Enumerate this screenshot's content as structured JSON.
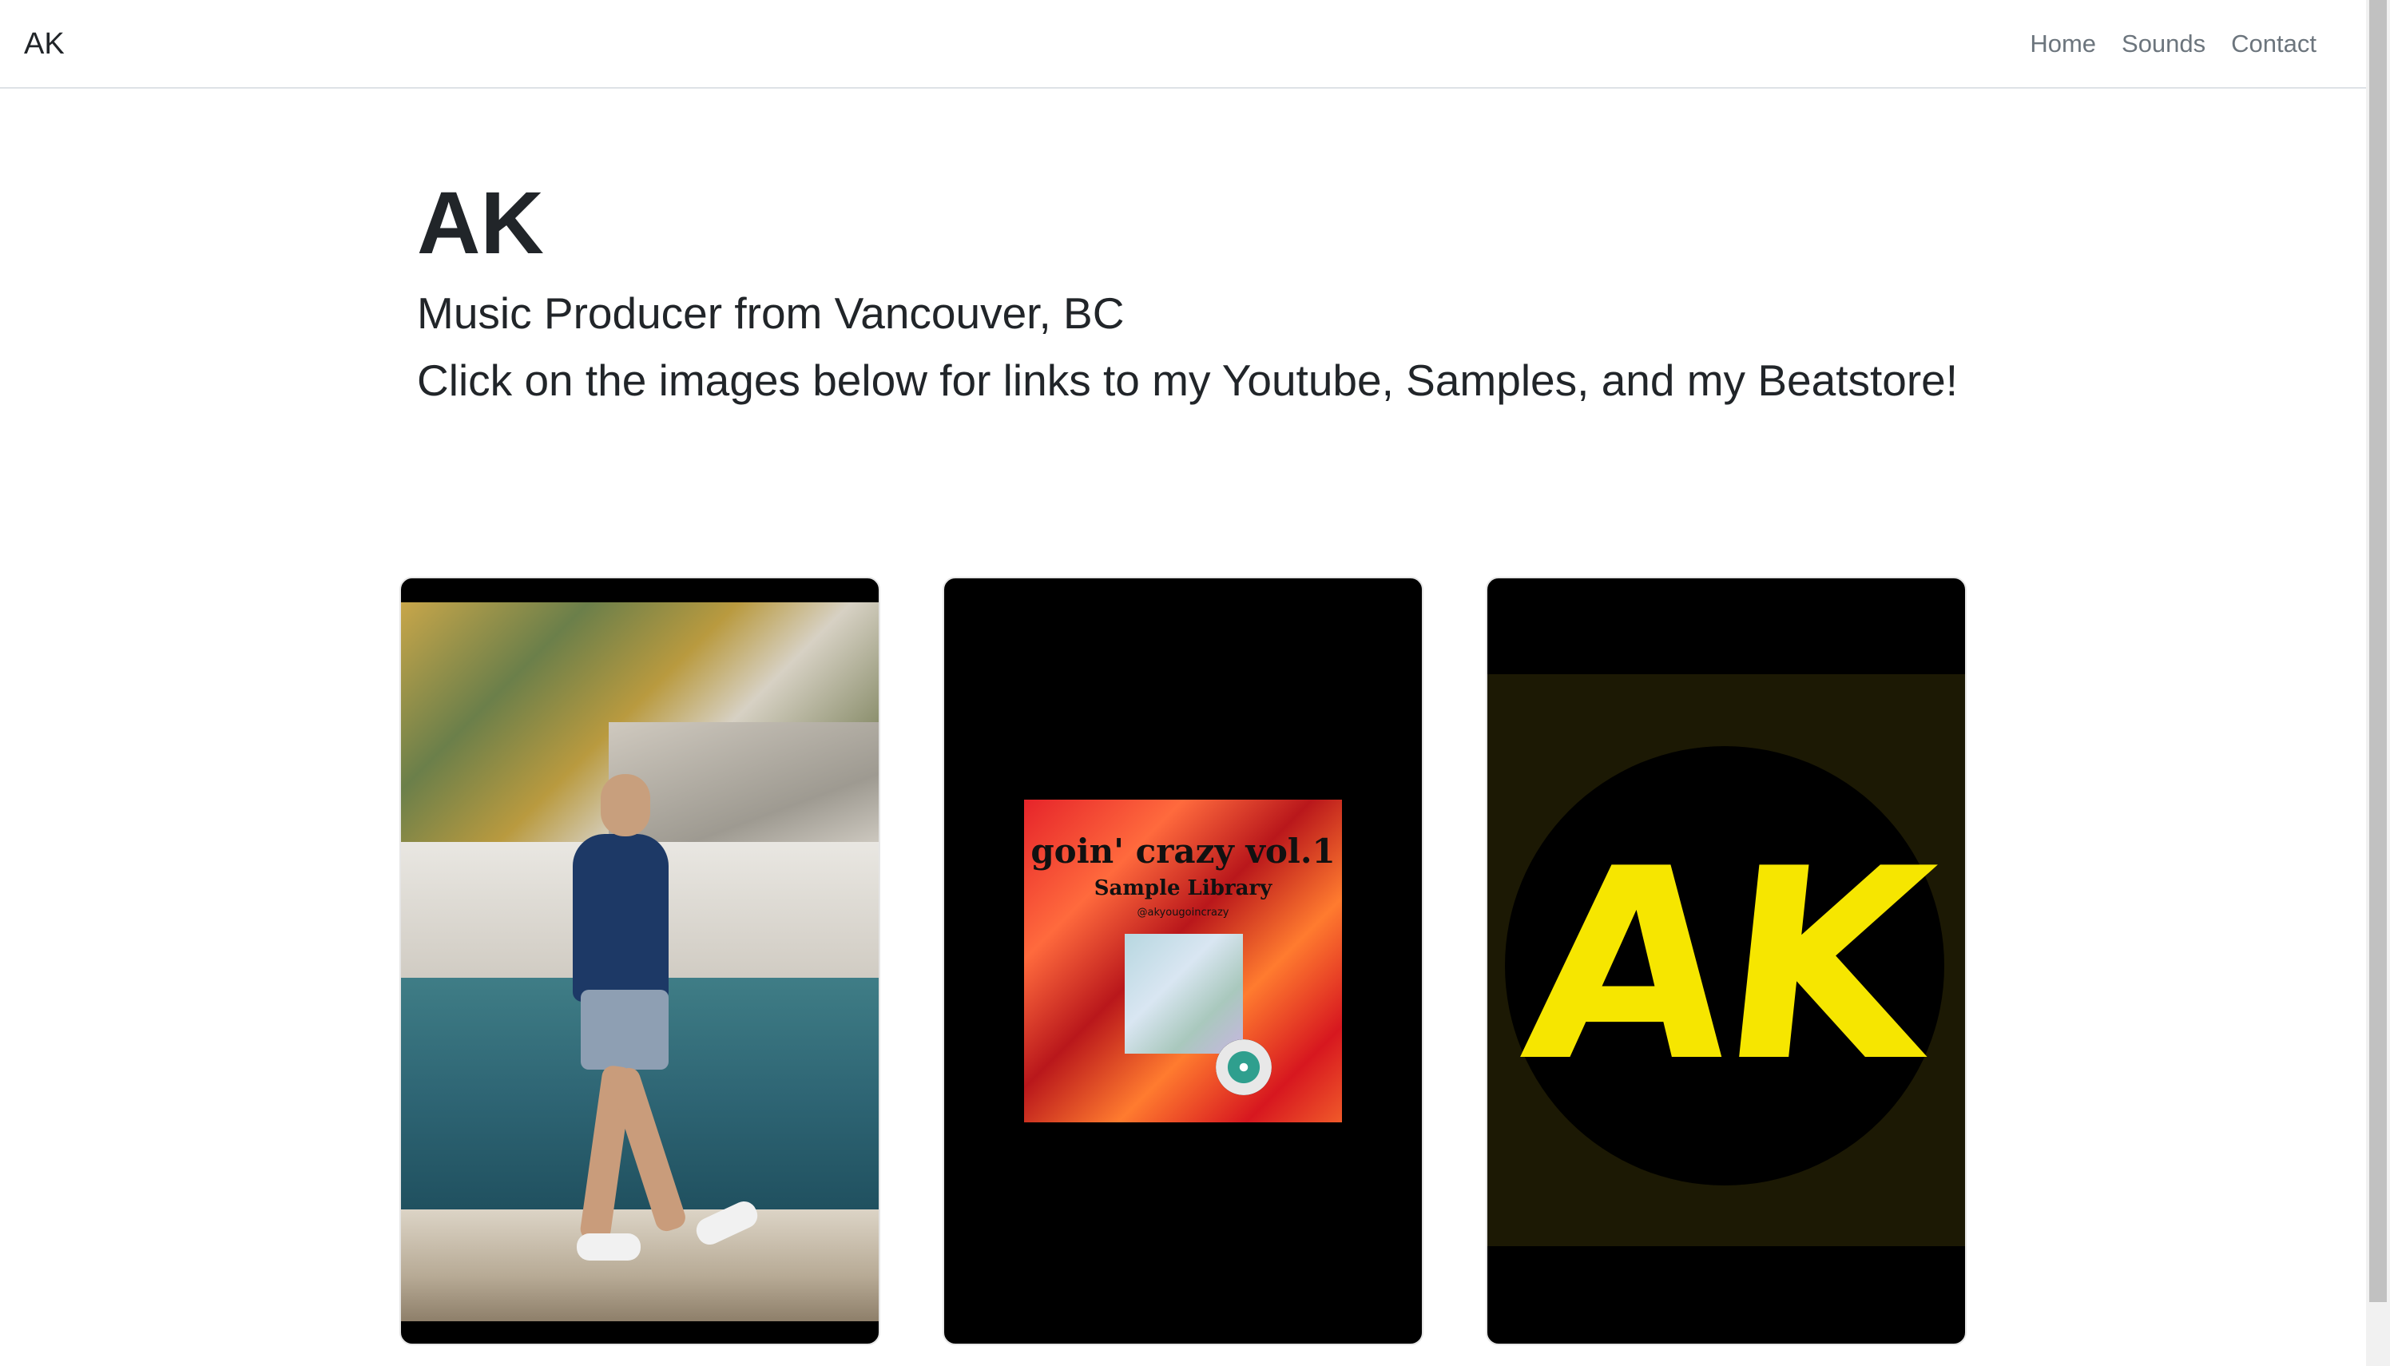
{
  "nav": {
    "brand": "AK",
    "links": [
      "Home",
      "Sounds",
      "Contact"
    ]
  },
  "hero": {
    "title": "AK",
    "subtitle": "Music Producer from Vancouver, BC",
    "description": "Click on the images below for links to my Youtube, Samples, and my Beatstore!"
  },
  "cards": [
    {
      "image": "photo of man walking on seawall"
    },
    {
      "image": "sample library album cover",
      "album_title": "goin' crazy vol.1",
      "album_subtitle": "Sample Library",
      "album_handle": "@akyougoincrazy"
    },
    {
      "image": "AK logo",
      "logo_text": "AK",
      "logo_color": "#f6e600"
    }
  ],
  "colors": {
    "text": "#212529",
    "nav_link": "#6c757d",
    "card_bg": "#000000"
  }
}
